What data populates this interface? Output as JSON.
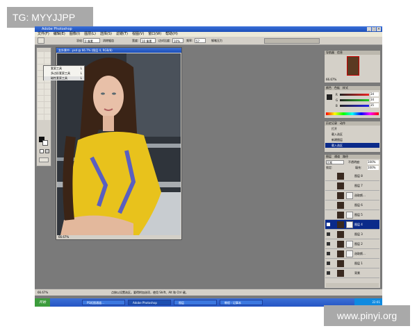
{
  "watermarks": {
    "top": "TG: MYYJJPP",
    "bottom": "www.pinyi.org"
  },
  "window": {
    "title": "Adobe Photoshop",
    "controls": [
      "_",
      "□",
      "×"
    ]
  },
  "menu": [
    "文件(F)",
    "编辑(E)",
    "图像(I)",
    "图层(L)",
    "选择(S)",
    "滤镜(T)",
    "视图(V)",
    "窗口(W)",
    "帮助(H)"
  ],
  "options": {
    "feather_label": "羽化:",
    "feather_value": "0 像素",
    "antialias": "消除锯齿",
    "width_label": "宽度:",
    "width_value": "10 像素",
    "edge_label": "边对比度:",
    "edge_value": "10%",
    "freq_label": "频率:",
    "freq_value": "57",
    "pen_pressure": "钢笔压力"
  },
  "flyout": {
    "items": [
      "套索工具",
      "多边形套索工具",
      "磁性套索工具"
    ],
    "shortcut": "L"
  },
  "document": {
    "title": "女外景中…psd @ 66.7% (图层 4, RGB/8)",
    "status": "66.67%"
  },
  "navigator": {
    "tabs": [
      "导航器",
      "信息"
    ],
    "zoom": "66.67%"
  },
  "color_panel": {
    "tabs": [
      "颜色",
      "色板",
      "样式"
    ],
    "channels": [
      "R",
      "G",
      "B"
    ],
    "values": [
      "34",
      "34",
      "35"
    ]
  },
  "history": {
    "tabs": [
      "历史记录",
      "动作"
    ],
    "items": [
      "打开",
      "载入选区",
      "新建图层",
      "载入选区"
    ]
  },
  "layers": {
    "tabs": [
      "图层",
      "通道",
      "路径"
    ],
    "blend_mode": "正常",
    "opacity_label": "不透明度:",
    "opacity_value": "100%",
    "fill_label": "填充:",
    "fill_value": "100%",
    "lock_label": "锁定:",
    "rows": [
      {
        "name": "图层 8",
        "visible": false,
        "mask": false,
        "selected": false
      },
      {
        "name": "图层 7",
        "visible": false,
        "mask": false,
        "selected": false
      },
      {
        "name": "选取颜…",
        "visible": false,
        "mask": true,
        "selected": false
      },
      {
        "name": "图层 6",
        "visible": false,
        "mask": false,
        "selected": false
      },
      {
        "name": "图层 5",
        "visible": false,
        "mask": true,
        "selected": false
      },
      {
        "name": "图层 4",
        "visible": true,
        "mask": true,
        "selected": true
      },
      {
        "name": "图层 3",
        "visible": true,
        "mask": false,
        "selected": false
      },
      {
        "name": "图层 2",
        "visible": true,
        "mask": true,
        "selected": false
      },
      {
        "name": "选取颜…",
        "visible": true,
        "mask": true,
        "selected": false
      },
      {
        "name": "图层 1",
        "visible": true,
        "mask": false,
        "selected": false
      },
      {
        "name": "背景",
        "visible": true,
        "mask": false,
        "selected": false
      }
    ]
  },
  "status_bar": {
    "zoom": "66.67%",
    "hint": "点按以设置选区。要得附加选项，使用 Shift、Alt 和 Ctrl 键。"
  },
  "taskbar": {
    "start": "开始",
    "buttons": [
      "PS抠图通道…",
      "Adobe Photoshop",
      "图层",
      "教程 - 记事本"
    ],
    "clock": "22:01"
  },
  "colors": {
    "selection": "#0a2a8a",
    "titlebar": "#2a5fc8",
    "workspace": "#7a7a7a",
    "panel": "#d4d0c8"
  },
  "icons": [
    "marquee-icon",
    "lasso-icon",
    "eye-icon",
    "brush-icon",
    "layer-mask-icon"
  ]
}
